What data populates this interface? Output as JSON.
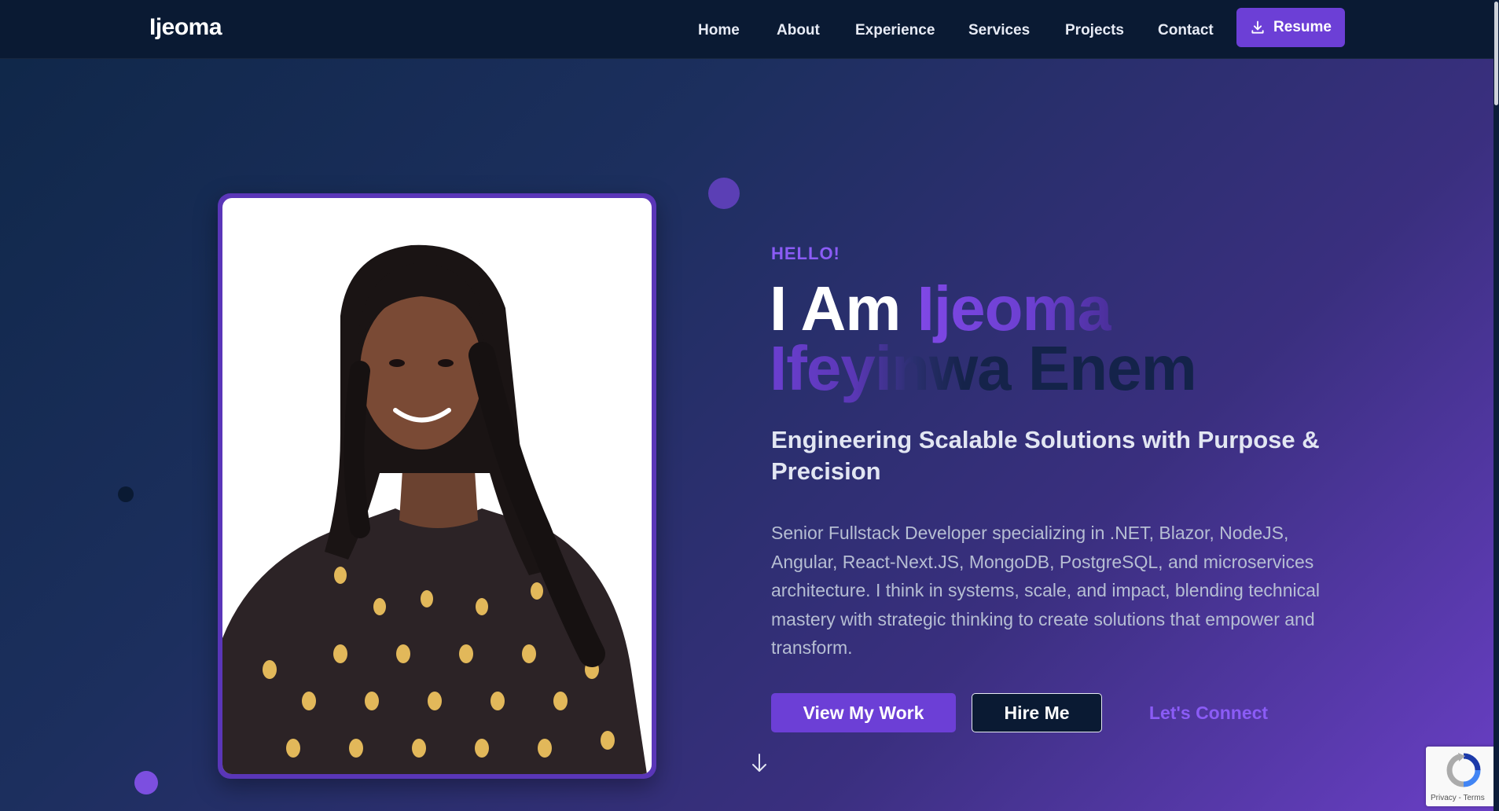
{
  "nav": {
    "brand": "Ijeoma",
    "links": [
      "Home",
      "About",
      "Experience",
      "Services",
      "Projects",
      "Contact"
    ],
    "resume_label": "Resume",
    "resume_icon": "download-icon"
  },
  "hero": {
    "greeting": "HELLO!",
    "headline": {
      "lead": "I Am",
      "first_name": "Ijeoma",
      "middle_name": "Ifeyinwa",
      "last_name": "Enem"
    },
    "subtitle": "Engineering Scalable Solutions with Purpose & Precision",
    "bio": "Senior Fullstack Developer specializing in .NET, Blazor, NodeJS, Angular, React-Next.JS, MongoDB, PostgreSQL, and microservices architecture. I think in systems, scale, and impact, blending technical mastery with strategic thinking to create solutions that empower and transform.",
    "buttons": {
      "view_work": "View My Work",
      "hire_me": "Hire Me",
      "connect": "Let's Connect"
    },
    "scroll_icon": "arrow-down-icon"
  },
  "recaptcha": {
    "links": "Privacy - Terms"
  },
  "colors": {
    "accent": "#6c3fd6",
    "accent_text": "#8b5cf6",
    "nav_bg": "#0a1a33"
  }
}
